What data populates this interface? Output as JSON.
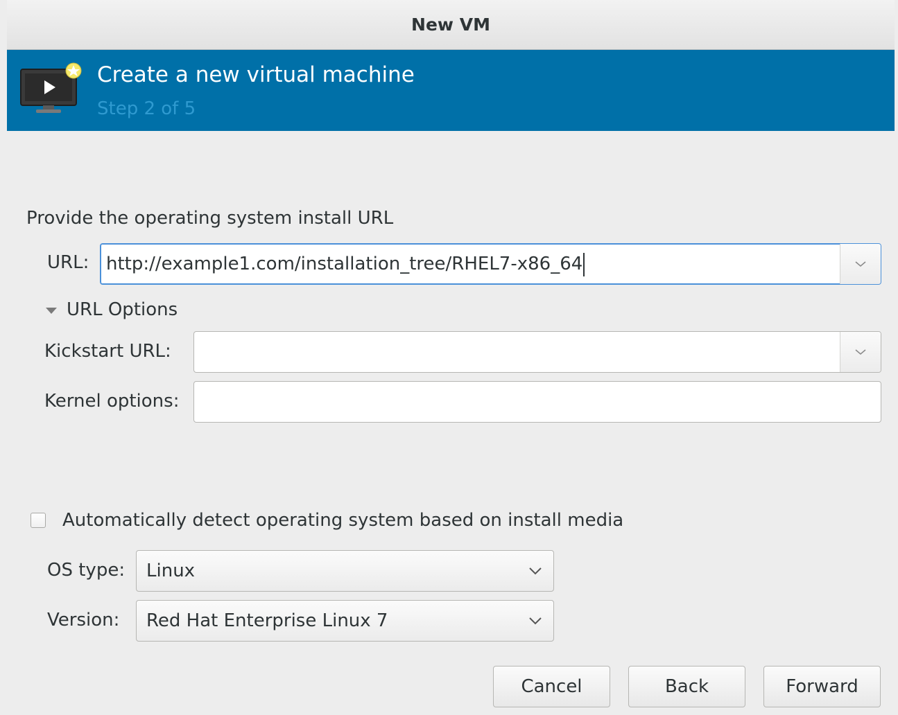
{
  "window": {
    "title": "New VM"
  },
  "header": {
    "icon": "monitor-play-icon",
    "title": "Create a new virtual machine",
    "step": "Step 2 of 5"
  },
  "install": {
    "section_label": "Provide the operating system install URL",
    "url_label": "URL:",
    "url_value": "http://example1.com/installation_tree/RHEL7-x86_64",
    "options_label": "URL Options",
    "kickstart_label": "Kickstart URL:",
    "kickstart_value": "",
    "kernel_label": "Kernel options:",
    "kernel_value": ""
  },
  "os": {
    "auto_detect_label": "Automatically detect operating system based on install media",
    "auto_detect_checked": false,
    "type_label": "OS type:",
    "type_value": "Linux",
    "version_label": "Version:",
    "version_value": "Red Hat Enterprise Linux 7"
  },
  "buttons": {
    "cancel": "Cancel",
    "back": "Back",
    "forward": "Forward"
  },
  "colors": {
    "header_bg": "#0070a8",
    "step_text": "#2f9ad0",
    "focus": "#4a90d9"
  }
}
